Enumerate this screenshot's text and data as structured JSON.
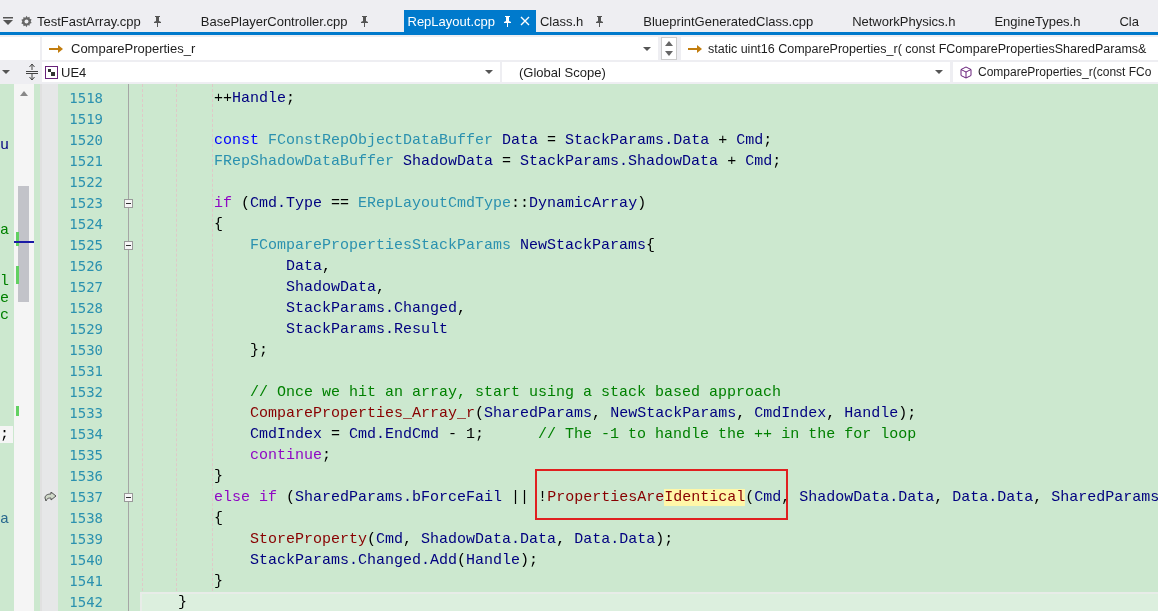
{
  "tabs": [
    {
      "label": "TestFastArray.cpp",
      "selected": false,
      "pinned": true
    },
    {
      "label": "BasePlayerController.cpp",
      "selected": false,
      "pinned": true
    },
    {
      "label": "RepLayout.cpp",
      "selected": true,
      "pinned": true
    },
    {
      "label": "Class.h",
      "selected": false,
      "pinned": true
    },
    {
      "label": "BlueprintGeneratedClass.cpp",
      "selected": false,
      "pinned": false
    },
    {
      "label": "NetworkPhysics.h",
      "selected": false,
      "pinned": false
    },
    {
      "label": "EngineTypes.h",
      "selected": false,
      "pinned": false
    },
    {
      "label": "Cla",
      "selected": false,
      "pinned": false
    }
  ],
  "navigation": {
    "member": "CompareProperties_r",
    "signature": "static uint16 CompareProperties_r( const FComparePropertiesSharedParams&",
    "project": "UE4",
    "scope": "(Global Scope)",
    "function": "CompareProperties_r(const FCo"
  },
  "split_pane": {
    "lines": [
      {
        "kind": "blank"
      },
      {
        "kind": "blank"
      },
      {
        "kind": "blank"
      },
      {
        "kind": "text",
        "text": "u"
      },
      {
        "kind": "blank"
      },
      {
        "kind": "blank"
      },
      {
        "kind": "blank"
      },
      {
        "kind": "blank"
      },
      {
        "kind": "text",
        "text": "a"
      },
      {
        "kind": "blank"
      },
      {
        "kind": "blank"
      },
      {
        "kind": "text",
        "text": "l"
      },
      {
        "kind": "text",
        "text": "e"
      },
      {
        "kind": "text",
        "text": "c"
      },
      {
        "kind": "blank"
      },
      {
        "kind": "blank"
      },
      {
        "kind": "blank"
      },
      {
        "kind": "blank"
      },
      {
        "kind": "blank"
      },
      {
        "kind": "blank"
      },
      {
        "kind": "current",
        "text": ";"
      },
      {
        "kind": "blank"
      },
      {
        "kind": "blank"
      },
      {
        "kind": "blank"
      },
      {
        "kind": "blank"
      },
      {
        "kind": "text",
        "text": "a"
      }
    ]
  },
  "code": {
    "lines": [
      {
        "number": "1518",
        "fold": false,
        "pointer": false,
        "current": false,
        "tokens": [
          {
            "text": "        ++",
            "kind": "plain"
          },
          {
            "text": "Handle",
            "kind": "var"
          },
          {
            "text": ";",
            "kind": "plain"
          }
        ]
      },
      {
        "number": "1519",
        "fold": false,
        "pointer": false,
        "current": false
      },
      {
        "number": "1520",
        "fold": false,
        "pointer": false,
        "current": false,
        "tokens": [
          {
            "text": "        const",
            "kind": "kw"
          },
          {
            "text": " FConstRepObjectDataBuffer",
            "kind": "type"
          },
          {
            "text": " Data",
            "kind": "var"
          },
          {
            "text": " = ",
            "kind": "plain"
          },
          {
            "text": "StackParams.Data",
            "kind": "var"
          },
          {
            "text": " + ",
            "kind": "plain"
          },
          {
            "text": "Cmd",
            "kind": "var"
          },
          {
            "text": ";",
            "kind": "plain"
          }
        ]
      },
      {
        "number": "1521",
        "fold": false,
        "pointer": false,
        "current": false,
        "tokens": [
          {
            "text": "        FRepShadowDataBuffer",
            "kind": "type"
          },
          {
            "text": " ShadowData",
            "kind": "var"
          },
          {
            "text": " = ",
            "kind": "plain"
          },
          {
            "text": "StackParams.ShadowData",
            "kind": "var"
          },
          {
            "text": " + ",
            "kind": "plain"
          },
          {
            "text": "Cmd",
            "kind": "var"
          },
          {
            "text": ";",
            "kind": "plain"
          }
        ]
      },
      {
        "number": "1522",
        "fold": false,
        "pointer": false,
        "current": false
      },
      {
        "number": "1523",
        "fold": true,
        "pointer": false,
        "current": false,
        "tokens": [
          {
            "text": "        if",
            "kind": "ctl"
          },
          {
            "text": " (",
            "kind": "plain"
          },
          {
            "text": "Cmd.Type",
            "kind": "var"
          },
          {
            "text": " == ",
            "kind": "plain"
          },
          {
            "text": "ERepLayoutCmdType",
            "kind": "type"
          },
          {
            "text": "::",
            "kind": "plain"
          },
          {
            "text": "DynamicArray",
            "kind": "var"
          },
          {
            "text": ")",
            "kind": "plain"
          }
        ]
      },
      {
        "number": "1524",
        "fold": false,
        "pointer": false,
        "current": false,
        "tokens": [
          {
            "text": "        {",
            "kind": "plain"
          }
        ]
      },
      {
        "number": "1525",
        "fold": true,
        "pointer": false,
        "current": false,
        "tokens": [
          {
            "text": "            FComparePropertiesStackParams",
            "kind": "type"
          },
          {
            "text": " NewStackParams",
            "kind": "var"
          },
          {
            "text": "{",
            "kind": "plain"
          }
        ]
      },
      {
        "number": "1526",
        "fold": false,
        "pointer": false,
        "current": false,
        "tokens": [
          {
            "text": "                Data",
            "kind": "var"
          },
          {
            "text": ",",
            "kind": "plain"
          }
        ]
      },
      {
        "number": "1527",
        "fold": false,
        "pointer": false,
        "current": false,
        "tokens": [
          {
            "text": "                ShadowData",
            "kind": "var"
          },
          {
            "text": ",",
            "kind": "plain"
          }
        ]
      },
      {
        "number": "1528",
        "fold": false,
        "pointer": false,
        "current": false,
        "tokens": [
          {
            "text": "                StackParams.Changed",
            "kind": "var"
          },
          {
            "text": ",",
            "kind": "plain"
          }
        ]
      },
      {
        "number": "1529",
        "fold": false,
        "pointer": false,
        "current": false,
        "tokens": [
          {
            "text": "                StackParams.Result",
            "kind": "var"
          }
        ]
      },
      {
        "number": "1530",
        "fold": false,
        "pointer": false,
        "current": false,
        "tokens": [
          {
            "text": "            };",
            "kind": "plain"
          }
        ]
      },
      {
        "number": "1531",
        "fold": false,
        "pointer": false,
        "current": false
      },
      {
        "number": "1532",
        "fold": false,
        "pointer": false,
        "current": false,
        "tokens": [
          {
            "text": "            // Once we hit an array, start using a stack based approach",
            "kind": "comment"
          }
        ]
      },
      {
        "number": "1533",
        "fold": false,
        "pointer": false,
        "current": false,
        "tokens": [
          {
            "text": "            CompareProperties_Array_r",
            "kind": "fn"
          },
          {
            "text": "(",
            "kind": "plain"
          },
          {
            "text": "SharedParams",
            "kind": "var"
          },
          {
            "text": ", ",
            "kind": "plain"
          },
          {
            "text": "NewStackParams",
            "kind": "var"
          },
          {
            "text": ", ",
            "kind": "plain"
          },
          {
            "text": "CmdIndex",
            "kind": "var"
          },
          {
            "text": ", ",
            "kind": "plain"
          },
          {
            "text": "Handle",
            "kind": "var"
          },
          {
            "text": ");",
            "kind": "plain"
          }
        ]
      },
      {
        "number": "1534",
        "fold": false,
        "pointer": false,
        "current": false,
        "tokens": [
          {
            "text": "            CmdIndex",
            "kind": "var"
          },
          {
            "text": " = ",
            "kind": "plain"
          },
          {
            "text": "Cmd.EndCmd",
            "kind": "var"
          },
          {
            "text": " - 1;",
            "kind": "plain"
          },
          {
            "text": "      // The -1 to handle the ++ in the for loop",
            "kind": "comment"
          }
        ]
      },
      {
        "number": "1535",
        "fold": false,
        "pointer": false,
        "current": false,
        "tokens": [
          {
            "text": "            continue",
            "kind": "ctl"
          },
          {
            "text": ";",
            "kind": "plain"
          }
        ]
      },
      {
        "number": "1536",
        "fold": false,
        "pointer": false,
        "current": false,
        "tokens": [
          {
            "text": "        }",
            "kind": "plain"
          }
        ]
      },
      {
        "number": "1537",
        "fold": true,
        "pointer": true,
        "current": false,
        "tokens": [
          {
            "text": "        else if",
            "kind": "ctl"
          },
          {
            "text": " (",
            "kind": "plain"
          },
          {
            "text": "SharedParams.bForceFail",
            "kind": "var"
          },
          {
            "text": " || ",
            "kind": "plain"
          },
          {
            "kind": "frame",
            "tokens": [
              {
                "text": "!",
                "kind": "plain"
              },
              {
                "text": "PropertiesAre",
                "kind": "fn"
              },
              {
                "text": "Identical",
                "kind": "match"
              },
              {
                "text": "(",
                "kind": "plain"
              },
              {
                "text": "Cmd",
                "kind": "var"
              }
            ]
          },
          {
            "text": ", ",
            "kind": "plain"
          },
          {
            "text": "ShadowData.Data",
            "kind": "var"
          },
          {
            "text": ", ",
            "kind": "plain"
          },
          {
            "text": "Data.Data",
            "kind": "var"
          },
          {
            "text": ", ",
            "kind": "plain"
          },
          {
            "text": "SharedParams",
            "kind": "var"
          }
        ]
      },
      {
        "number": "1538",
        "fold": false,
        "pointer": false,
        "current": false,
        "tokens": [
          {
            "text": "        {",
            "kind": "plain"
          }
        ]
      },
      {
        "number": "1539",
        "fold": false,
        "pointer": false,
        "current": false,
        "tokens": [
          {
            "text": "            StoreProperty",
            "kind": "fn"
          },
          {
            "text": "(",
            "kind": "plain"
          },
          {
            "text": "Cmd",
            "kind": "var"
          },
          {
            "text": ", ",
            "kind": "plain"
          },
          {
            "text": "ShadowData.Data",
            "kind": "var"
          },
          {
            "text": ", ",
            "kind": "plain"
          },
          {
            "text": "Data.Data",
            "kind": "var"
          },
          {
            "text": ");",
            "kind": "plain"
          }
        ]
      },
      {
        "number": "1540",
        "fold": false,
        "pointer": false,
        "current": false,
        "tokens": [
          {
            "text": "            StackParams.Changed.Add",
            "kind": "var"
          },
          {
            "text": "(",
            "kind": "plain"
          },
          {
            "text": "Handle",
            "kind": "var"
          },
          {
            "text": ");",
            "kind": "plain"
          }
        ]
      },
      {
        "number": "1541",
        "fold": false,
        "pointer": false,
        "current": false,
        "tokens": [
          {
            "text": "        }",
            "kind": "plain"
          }
        ]
      },
      {
        "number": "1542",
        "fold": false,
        "pointer": false,
        "current": true,
        "tokens": [
          {
            "text": "    }",
            "kind": "plain"
          }
        ]
      }
    ]
  }
}
